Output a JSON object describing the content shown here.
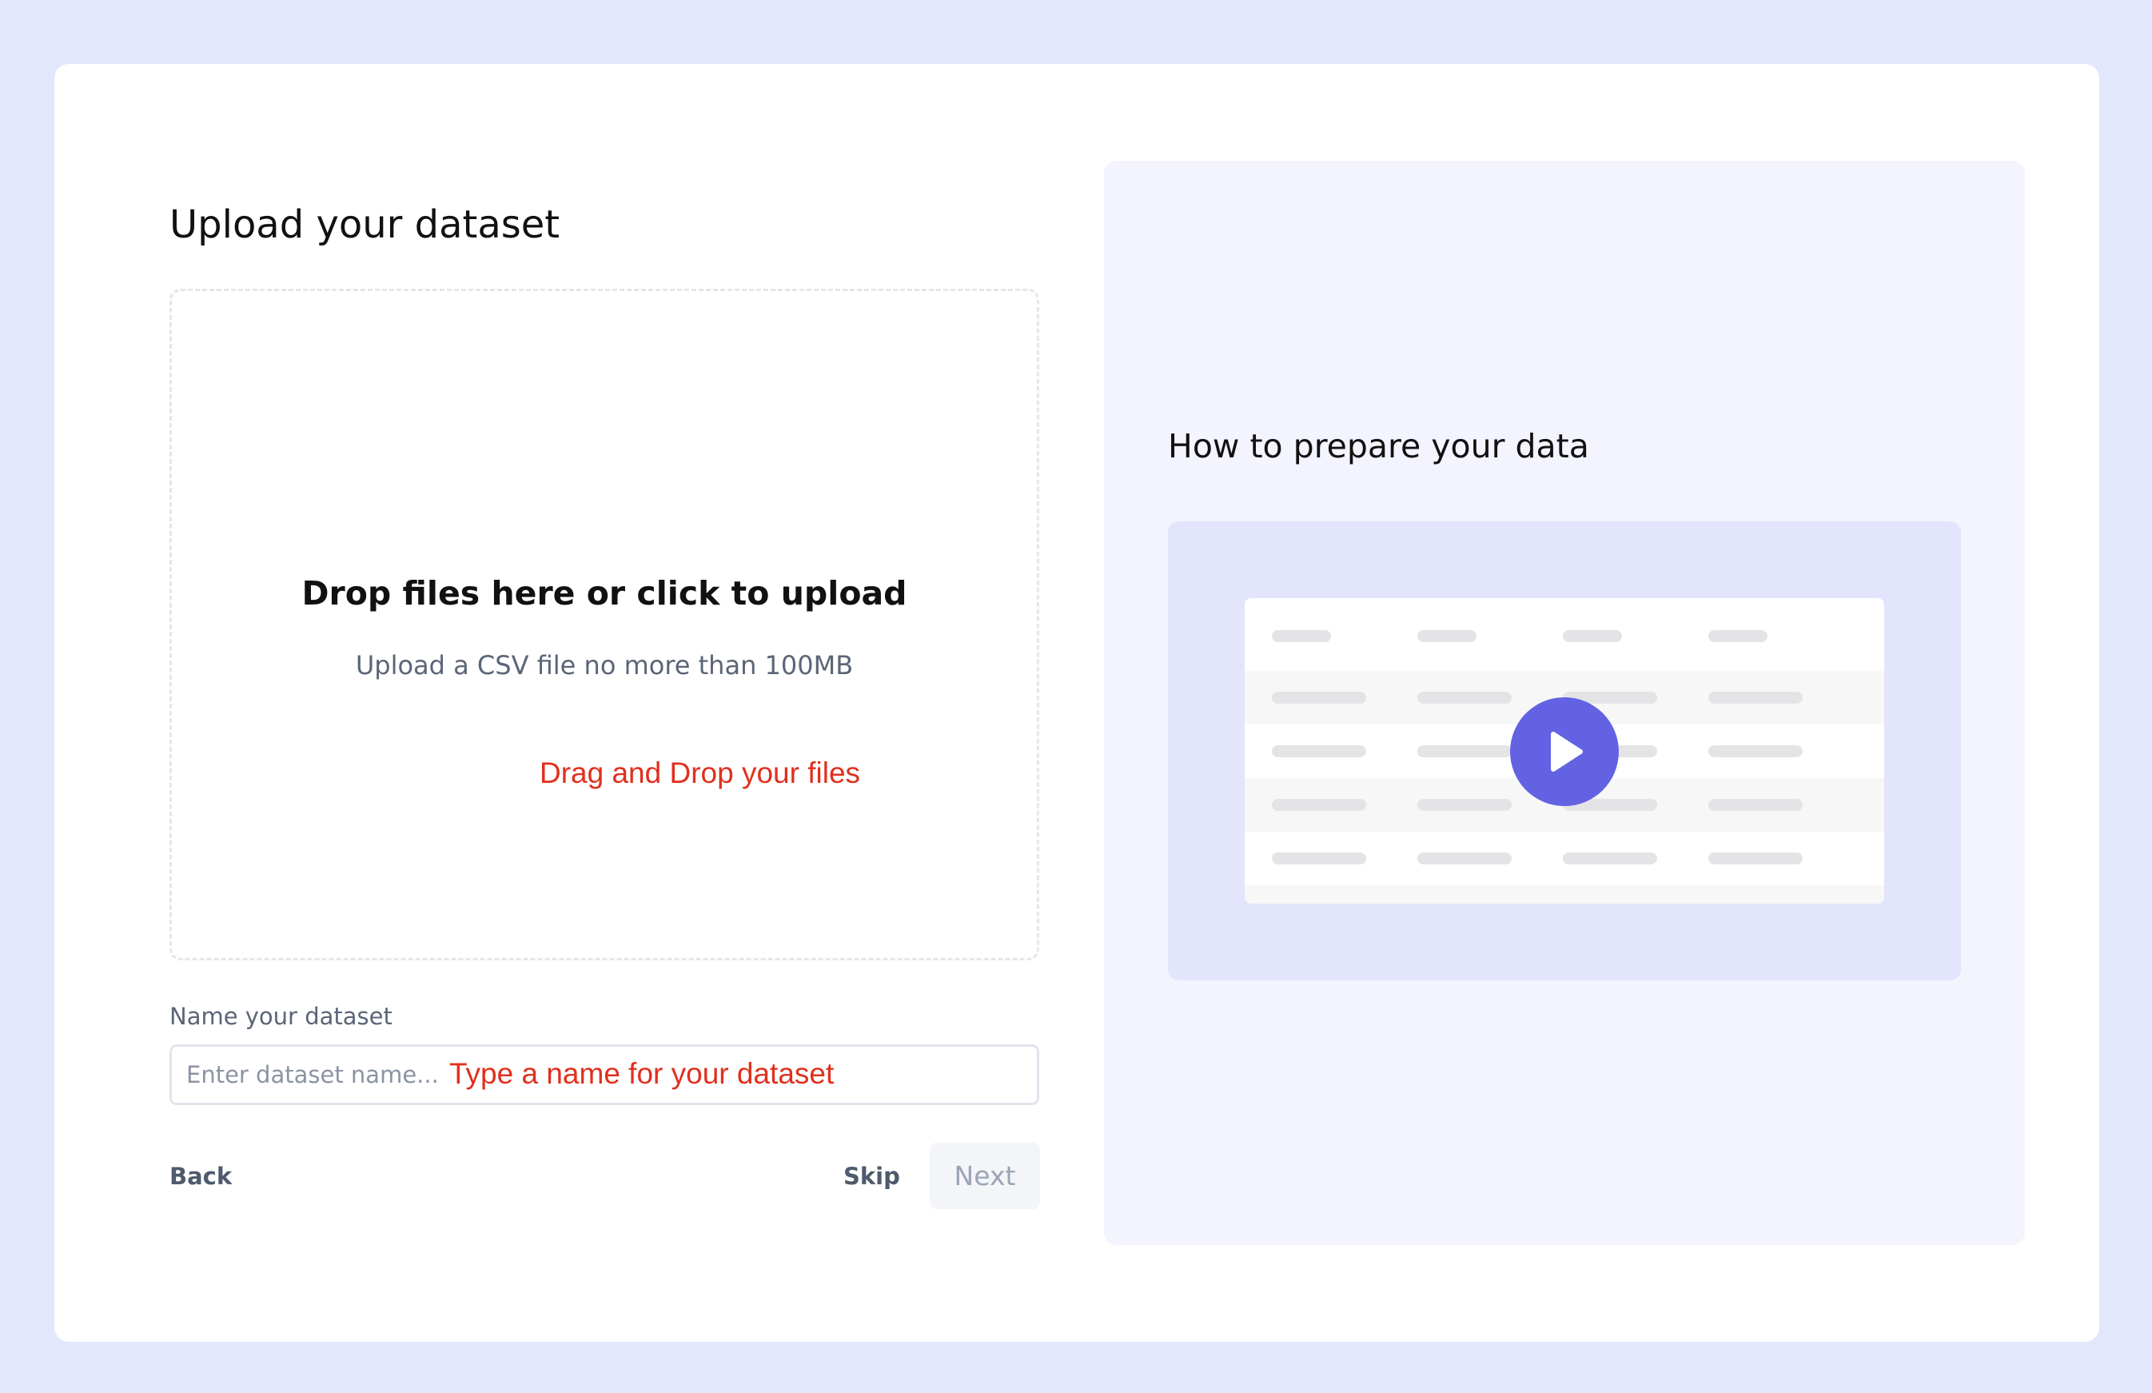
{
  "left": {
    "title": "Upload your dataset",
    "dropzone": {
      "title": "Drop files here or click to upload",
      "subtitle": "Upload a CSV file no more than 100MB",
      "annotation": "Drag and Drop your files"
    },
    "name_field": {
      "label": "Name your dataset",
      "placeholder": "Enter dataset name...",
      "value": "",
      "annotation": "Type a name for your dataset"
    },
    "actions": {
      "back_label": "Back",
      "skip_label": "Skip",
      "next_label": "Next",
      "next_enabled": false
    }
  },
  "right": {
    "title": "How to prepare your data",
    "video": {
      "icon": "play-icon",
      "thumbnail": "table-preview"
    }
  },
  "colors": {
    "background": "#e3e7fb",
    "accent": "#6262e3",
    "annotation": "#e0301e",
    "panel": "#f3f4fd"
  }
}
